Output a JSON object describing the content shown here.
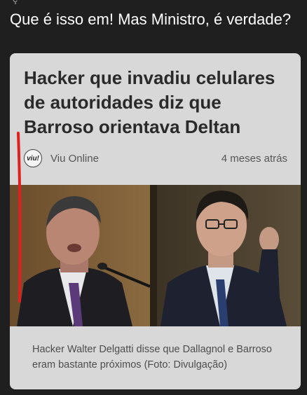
{
  "post": {
    "top_fragment": "ç",
    "text": "Que é isso em! Mas Ministro, é verdade?"
  },
  "card": {
    "headline": "Hacker que invadiu celulares de autoridades diz que Barroso orientava Deltan",
    "source_logo_text": "viu!",
    "source_name": "Viu Online",
    "time": "4 meses atrás",
    "caption": "Hacker Walter Delgatti disse que Dallagnol e Barroso eram bastante próximos (Foto: Divulgação)"
  },
  "colors": {
    "background": "#1f1f1f",
    "card": "#d8d8d8",
    "annotation_red": "#e02020"
  }
}
